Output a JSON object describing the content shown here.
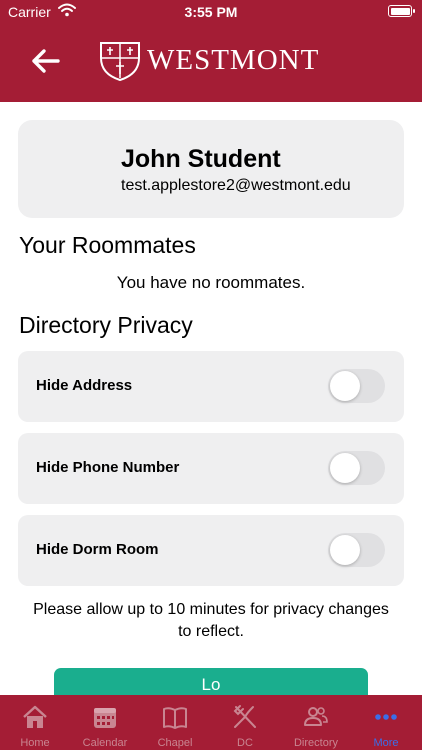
{
  "status_bar": {
    "carrier": "Carrier",
    "time": "3:55 PM"
  },
  "header": {
    "logo_text": "WESTMONT"
  },
  "profile": {
    "name": "John Student",
    "email": "test.applestore2@westmont.edu"
  },
  "roommates": {
    "title": "Your Roommates",
    "empty_text": "You have no roommates."
  },
  "privacy": {
    "title": "Directory Privacy",
    "toggles": [
      {
        "label": "Hide Address",
        "on": false
      },
      {
        "label": "Hide Phone Number",
        "on": false
      },
      {
        "label": "Hide Dorm Room",
        "on": false
      }
    ],
    "note": "Please allow up to 10 minutes for privacy changes to reflect."
  },
  "logout_button": {
    "label": "Lo"
  },
  "tabbar": {
    "tabs": [
      {
        "label": "Home",
        "icon": "home-icon"
      },
      {
        "label": "Calendar",
        "icon": "calendar-icon"
      },
      {
        "label": "Chapel",
        "icon": "book-icon"
      },
      {
        "label": "DC",
        "icon": "fork-knife-icon"
      },
      {
        "label": "Directory",
        "icon": "people-icon"
      },
      {
        "label": "More",
        "icon": "more-dots-icon"
      }
    ],
    "active_index": 5
  },
  "colors": {
    "brand": "#a41d35",
    "accent": "#1aae8e",
    "active_tab": "#3b6ee8"
  }
}
